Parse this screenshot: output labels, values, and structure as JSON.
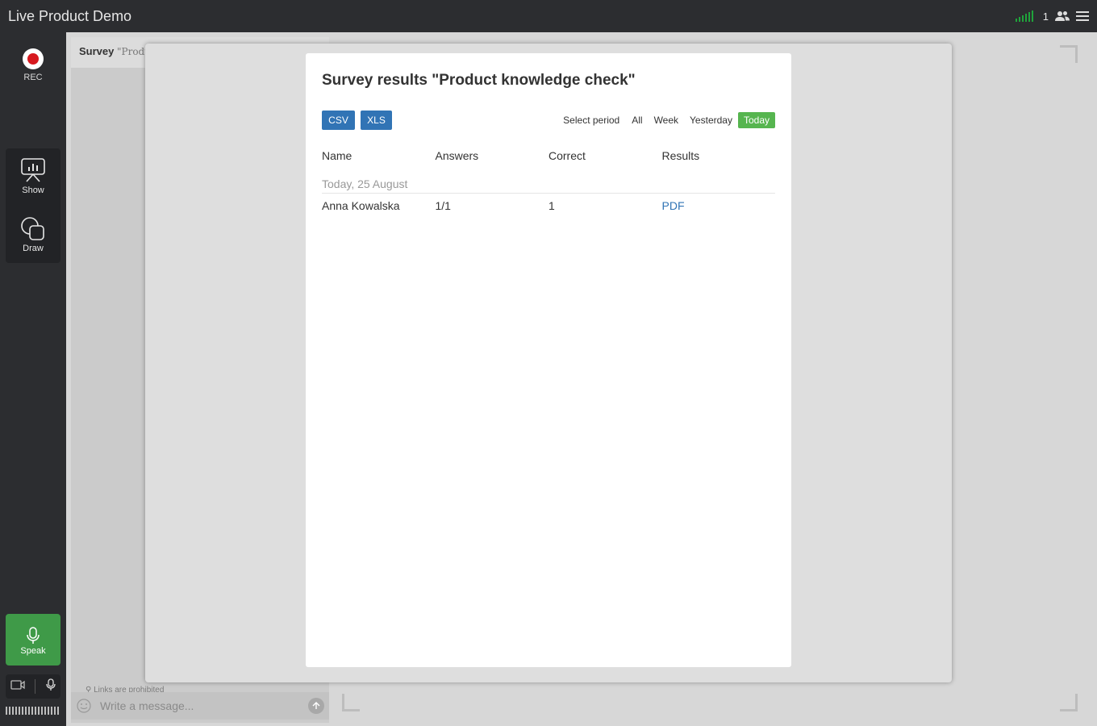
{
  "app": {
    "title": "Live Product Demo",
    "participants_count": "1"
  },
  "rail": {
    "rec_label": "REC",
    "show_label": "Show",
    "draw_label": "Draw",
    "speak_label": "Speak"
  },
  "survey_panel": {
    "heading": "Survey",
    "subtitle": "\"Produ",
    "links_note": "Links are prohibited",
    "message_placeholder": "Write a message..."
  },
  "dialog": {
    "title": "Survey results \"Product knowledge check\"",
    "export_csv": "CSV",
    "export_xls": "XLS",
    "period_label": "Select period",
    "periods": [
      "All",
      "Week",
      "Yesterday",
      "Today"
    ],
    "active_period": "Today",
    "columns": [
      "Name",
      "Answers",
      "Correct",
      "Results"
    ],
    "group": "Today, 25 August",
    "rows": [
      {
        "name": "Anna Kowalska",
        "answers": "1/1",
        "correct": "1",
        "results": "PDF"
      }
    ]
  },
  "colors": {
    "accent_blue": "#3174b5",
    "active_green": "#56b54f",
    "speak_green": "#3f9a48",
    "rec_red": "#d7191f"
  }
}
